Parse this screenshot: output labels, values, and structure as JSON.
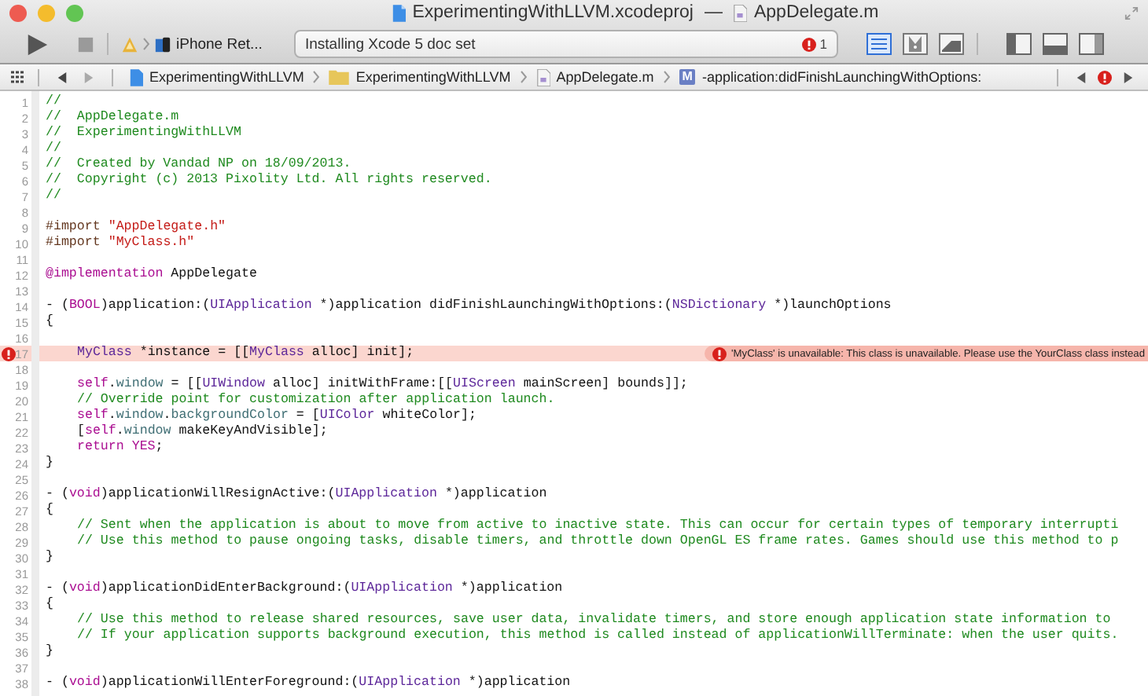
{
  "window": {
    "title_project": "ExperimentingWithLLVM.xcodeproj",
    "title_separator": "—",
    "title_file": "AppDelegate.m"
  },
  "toolbar": {
    "scheme_device": "iPhone Ret...",
    "activity": "Installing Xcode 5 doc set",
    "issue_count": "1",
    "editor_modes": [
      {
        "kind": "standard",
        "selected": true
      },
      {
        "kind": "assistant",
        "selected": false
      },
      {
        "kind": "version",
        "selected": false
      }
    ],
    "view_toggles": [
      {
        "kind": "navigator"
      },
      {
        "kind": "debug"
      },
      {
        "kind": "utilities"
      }
    ]
  },
  "jump_bar": {
    "path": [
      {
        "kind": "project",
        "label": "ExperimentingWithLLVM"
      },
      {
        "kind": "folder",
        "label": "ExperimentingWithLLVM"
      },
      {
        "kind": "file",
        "label": "AppDelegate.m"
      },
      {
        "kind": "method",
        "badge": "M",
        "label": "-application:didFinishLaunchingWithOptions:"
      }
    ]
  },
  "editor": {
    "lines": [
      {
        "n": "1",
        "tokens": [
          {
            "kind": "comment",
            "text": "//"
          }
        ]
      },
      {
        "n": "2",
        "tokens": [
          {
            "kind": "comment",
            "text": "//  AppDelegate.m"
          }
        ]
      },
      {
        "n": "3",
        "tokens": [
          {
            "kind": "comment",
            "text": "//  ExperimentingWithLLVM"
          }
        ]
      },
      {
        "n": "4",
        "tokens": [
          {
            "kind": "comment",
            "text": "//"
          }
        ]
      },
      {
        "n": "5",
        "tokens": [
          {
            "kind": "comment",
            "text": "//  Created by Vandad NP on 18/09/2013."
          }
        ]
      },
      {
        "n": "6",
        "tokens": [
          {
            "kind": "comment",
            "text": "//  Copyright (c) 2013 Pixolity Ltd. All rights reserved."
          }
        ]
      },
      {
        "n": "7",
        "tokens": [
          {
            "kind": "comment",
            "text": "//"
          }
        ]
      },
      {
        "n": "8"
      },
      {
        "n": "9",
        "tokens": [
          {
            "kind": "directive",
            "text": "#import "
          },
          {
            "kind": "string",
            "text": "\"AppDelegate.h\""
          }
        ]
      },
      {
        "n": "10",
        "tokens": [
          {
            "kind": "directive",
            "text": "#import "
          },
          {
            "kind": "string",
            "text": "\"MyClass.h\""
          }
        ]
      },
      {
        "n": "11"
      },
      {
        "n": "12",
        "tokens": [
          {
            "kind": "keyword",
            "text": "@implementation"
          },
          {
            "kind": "plain",
            "text": " AppDelegate"
          }
        ]
      },
      {
        "n": "13"
      },
      {
        "n": "14",
        "tokens": [
          {
            "kind": "plain",
            "text": "- ("
          },
          {
            "kind": "keyword",
            "text": "BOOL"
          },
          {
            "kind": "plain",
            "text": ")application:("
          },
          {
            "kind": "type",
            "text": "UIApplication"
          },
          {
            "kind": "plain",
            "text": " *)application didFinishLaunchingWithOptions:("
          },
          {
            "kind": "type",
            "text": "NSDictionary"
          },
          {
            "kind": "plain",
            "text": " *)launchOptions"
          }
        ]
      },
      {
        "n": "15",
        "tokens": [
          {
            "kind": "plain",
            "text": "{"
          }
        ]
      },
      {
        "n": "16"
      },
      {
        "n": "17",
        "indented": true,
        "error": true,
        "message": "'MyClass' is unavailable: This class is unavailable. Please use the YourClass class instead",
        "tokens": [
          {
            "kind": "type",
            "text": "MyClass"
          },
          {
            "kind": "plain",
            "text": " *instance = [["
          },
          {
            "kind": "type",
            "text": "MyClass"
          },
          {
            "kind": "plain",
            "text": " alloc] init];"
          }
        ]
      },
      {
        "n": "18"
      },
      {
        "n": "19",
        "indented": true,
        "tokens": [
          {
            "kind": "keyword",
            "text": "self"
          },
          {
            "kind": "plain",
            "text": "."
          },
          {
            "kind": "property",
            "text": "window"
          },
          {
            "kind": "plain",
            "text": " = [["
          },
          {
            "kind": "type",
            "text": "UIWindow"
          },
          {
            "kind": "plain",
            "text": " alloc] initWithFrame:[["
          },
          {
            "kind": "type",
            "text": "UIScreen"
          },
          {
            "kind": "plain",
            "text": " mainScreen] bounds]];"
          }
        ]
      },
      {
        "n": "20",
        "indented": true,
        "tokens": [
          {
            "kind": "comment",
            "text": "// Override point for customization after application launch."
          }
        ]
      },
      {
        "n": "21",
        "indented": true,
        "tokens": [
          {
            "kind": "keyword",
            "text": "self"
          },
          {
            "kind": "plain",
            "text": "."
          },
          {
            "kind": "property",
            "text": "window"
          },
          {
            "kind": "plain",
            "text": "."
          },
          {
            "kind": "property",
            "text": "backgroundColor"
          },
          {
            "kind": "plain",
            "text": " = ["
          },
          {
            "kind": "type",
            "text": "UIColor"
          },
          {
            "kind": "plain",
            "text": " whiteColor];"
          }
        ]
      },
      {
        "n": "22",
        "indented": true,
        "tokens": [
          {
            "kind": "plain",
            "text": "["
          },
          {
            "kind": "keyword",
            "text": "self"
          },
          {
            "kind": "plain",
            "text": "."
          },
          {
            "kind": "property",
            "text": "window"
          },
          {
            "kind": "plain",
            "text": " makeKeyAndVisible];"
          }
        ]
      },
      {
        "n": "23",
        "indented": true,
        "tokens": [
          {
            "kind": "keyword",
            "text": "return YES"
          },
          {
            "kind": "plain",
            "text": ";"
          }
        ]
      },
      {
        "n": "24",
        "tokens": [
          {
            "kind": "plain",
            "text": "}"
          }
        ]
      },
      {
        "n": "25"
      },
      {
        "n": "26",
        "tokens": [
          {
            "kind": "plain",
            "text": "- ("
          },
          {
            "kind": "keyword",
            "text": "void"
          },
          {
            "kind": "plain",
            "text": ")applicationWillResignActive:("
          },
          {
            "kind": "type",
            "text": "UIApplication"
          },
          {
            "kind": "plain",
            "text": " *)application"
          }
        ]
      },
      {
        "n": "27",
        "tokens": [
          {
            "kind": "plain",
            "text": "{"
          }
        ]
      },
      {
        "n": "28",
        "indented": true,
        "tokens": [
          {
            "kind": "comment",
            "text": "// Sent when the application is about to move from active to inactive state. This can occur for certain types of temporary interrupti"
          }
        ]
      },
      {
        "n": "29",
        "indented": true,
        "tokens": [
          {
            "kind": "comment",
            "text": "// Use this method to pause ongoing tasks, disable timers, and throttle down OpenGL ES frame rates. Games should use this method to p"
          }
        ]
      },
      {
        "n": "30",
        "tokens": [
          {
            "kind": "plain",
            "text": "}"
          }
        ]
      },
      {
        "n": "31"
      },
      {
        "n": "32",
        "tokens": [
          {
            "kind": "plain",
            "text": "- ("
          },
          {
            "kind": "keyword",
            "text": "void"
          },
          {
            "kind": "plain",
            "text": ")applicationDidEnterBackground:("
          },
          {
            "kind": "type",
            "text": "UIApplication"
          },
          {
            "kind": "plain",
            "text": " *)application"
          }
        ]
      },
      {
        "n": "33",
        "tokens": [
          {
            "kind": "plain",
            "text": "{"
          }
        ]
      },
      {
        "n": "34",
        "indented": true,
        "tokens": [
          {
            "kind": "comment",
            "text": "// Use this method to release shared resources, save user data, invalidate timers, and store enough application state information to"
          }
        ]
      },
      {
        "n": "35",
        "indented": true,
        "tokens": [
          {
            "kind": "comment",
            "text": "// If your application supports background execution, this method is called instead of applicationWillTerminate: when the user quits."
          }
        ]
      },
      {
        "n": "36",
        "tokens": [
          {
            "kind": "plain",
            "text": "}"
          }
        ]
      },
      {
        "n": "37"
      },
      {
        "n": "38",
        "tokens": [
          {
            "kind": "plain",
            "text": "- ("
          },
          {
            "kind": "keyword",
            "text": "void"
          },
          {
            "kind": "plain",
            "text": ")applicationWillEnterForeground:("
          },
          {
            "kind": "type",
            "text": "UIApplication"
          },
          {
            "kind": "plain",
            "text": " *)application"
          }
        ]
      }
    ]
  }
}
